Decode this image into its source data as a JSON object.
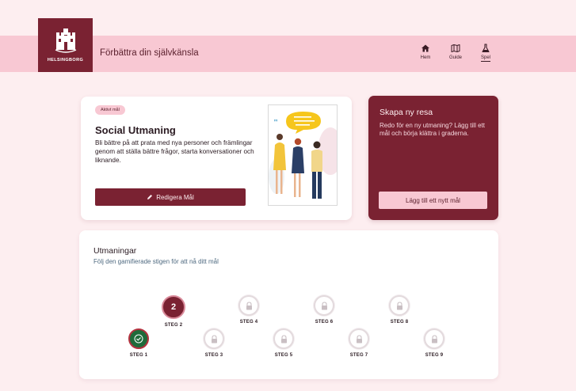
{
  "header": {
    "logo_text": "HELSINGBORG",
    "title": "Förbättra din självkänsla",
    "nav": [
      {
        "label": "Hem",
        "icon": "home-icon",
        "active": false
      },
      {
        "label": "Guide",
        "icon": "map-icon",
        "active": false
      },
      {
        "label": "Spel",
        "icon": "flask-icon",
        "active": true
      }
    ]
  },
  "goal": {
    "badge": "Aktivt mål",
    "title": "Social Utmaning",
    "description": "Bli bättre på att prata med nya personer och främlingar genom att ställa bättre frågor, starta konversationer och liknande.",
    "edit_label": "Redigera Mål"
  },
  "new_journey": {
    "title": "Skapa ny resa",
    "description": "Redo för en ny utmaning? Lägg till ett mål och börja klättra i graderna.",
    "button_label": "Lägg till ett nytt mål"
  },
  "challenges": {
    "title": "Utmaningar",
    "subtitle": "Följ den gamifierade stigen för att nå ditt mål",
    "steps": [
      {
        "label": "STEG 1",
        "status": "done"
      },
      {
        "label": "STEG 2",
        "status": "current",
        "number": "2"
      },
      {
        "label": "STEG 3",
        "status": "locked"
      },
      {
        "label": "STEG 4",
        "status": "locked"
      },
      {
        "label": "STEG 5",
        "status": "locked"
      },
      {
        "label": "STEG 6",
        "status": "locked"
      },
      {
        "label": "STEG 7",
        "status": "locked"
      },
      {
        "label": "STEG 8",
        "status": "locked"
      },
      {
        "label": "STEG 9",
        "status": "locked"
      }
    ]
  },
  "colors": {
    "background": "#fdeef0",
    "header": "#f8c8d3",
    "brand": "#7a2232",
    "done": "#1f6b3a"
  }
}
